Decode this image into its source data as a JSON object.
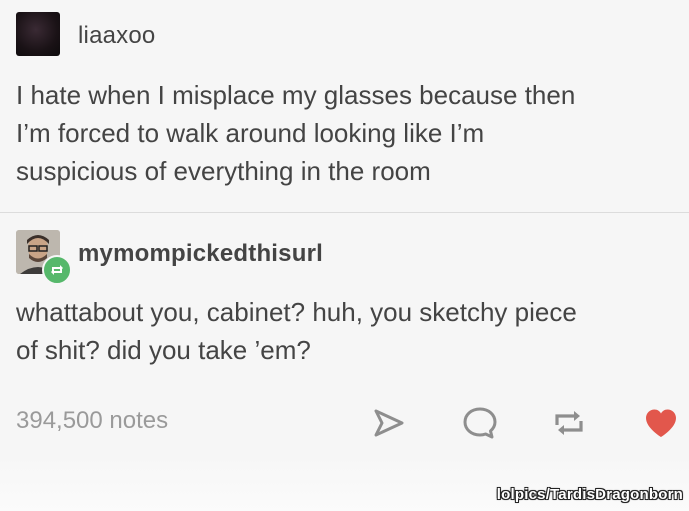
{
  "post1": {
    "username": "liaaxoo",
    "text": "I hate when I misplace my glasses because then\nI’m forced to walk around looking like I’m\nsuspicious of everything in the room"
  },
  "post2": {
    "username": "mymompickedthisurl",
    "text": "whattabout you, cabinet? huh, you sketchy piece\nof shit? did you take ’em?"
  },
  "footer": {
    "notes": "394,500 notes",
    "icons": [
      "share-icon",
      "reply-icon",
      "reblog-icon",
      "like-icon"
    ]
  },
  "watermark": "lolpics/TardisDragonborn",
  "colors": {
    "like": "#e2574c",
    "reblog_badge": "#56b86b",
    "icon_gray": "#8e8e8e",
    "text": "#444444"
  }
}
